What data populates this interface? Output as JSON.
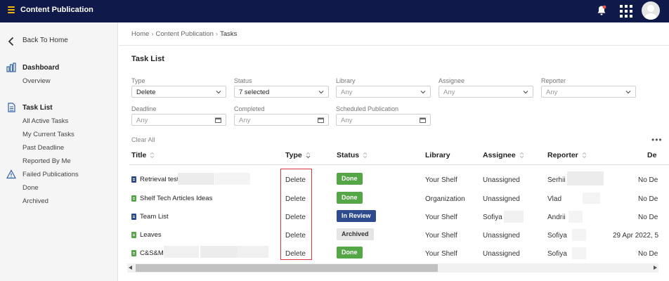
{
  "app": {
    "title": "Content Publication"
  },
  "sidebar": {
    "back_label": "Back To Home",
    "dashboard": {
      "label": "Dashboard",
      "items": [
        "Overview"
      ]
    },
    "tasks": {
      "label": "Task List",
      "items": [
        "All Active Tasks",
        "My Current Tasks",
        "Past Deadline",
        "Reported By Me",
        "Failed Publications",
        "Done",
        "Archived"
      ]
    }
  },
  "breadcrumb": [
    "Home",
    "Content Publication",
    "Tasks"
  ],
  "breadcrumb_sep": "›",
  "page_title": "Task List",
  "filters": [
    {
      "label": "Type",
      "value": "Delete",
      "kind": "select",
      "filled": true
    },
    {
      "label": "Status",
      "value": "7 selected",
      "kind": "select",
      "filled": true
    },
    {
      "label": "Library",
      "value": "Any",
      "kind": "select",
      "filled": false
    },
    {
      "label": "Assignee",
      "value": "Any",
      "kind": "select",
      "filled": false
    },
    {
      "label": "Reporter",
      "value": "Any",
      "kind": "select",
      "filled": false
    },
    {
      "label": "Deadline",
      "value": "Any",
      "kind": "date",
      "filled": false
    },
    {
      "label": "Completed",
      "value": "Any",
      "kind": "date",
      "filled": false
    },
    {
      "label": "Scheduled Publication",
      "value": "Any",
      "kind": "date",
      "filled": false
    }
  ],
  "clear_all": "Clear All",
  "more": "•••",
  "table": {
    "headers": [
      "Title",
      "Type",
      "Status",
      "Library",
      "Assignee",
      "Reporter",
      "De"
    ],
    "rows": [
      {
        "title": "Retrieval test",
        "badge": "blue",
        "type": "Delete",
        "status": "Done",
        "status_kind": "done",
        "library": "Your Shelf",
        "assignee": "Unassigned",
        "reporter": "Serhii",
        "deadline": "No De"
      },
      {
        "title": "Shelf Tech Articles Ideas",
        "badge": "green",
        "type": "Delete",
        "status": "Done",
        "status_kind": "done",
        "library": "Organization",
        "assignee": "Unassigned",
        "reporter": "Vlad",
        "deadline": "No De"
      },
      {
        "title": "Team List",
        "badge": "blue",
        "type": "Delete",
        "status": "In Review",
        "status_kind": "review",
        "library": "Your Shelf",
        "assignee": "Sofiya",
        "reporter": "Andrii",
        "deadline": "No De"
      },
      {
        "title": "Leaves",
        "badge": "green",
        "type": "Delete",
        "status": "Archived",
        "status_kind": "archived",
        "library": "Your Shelf",
        "assignee": "Unassigned",
        "reporter": "Sofiya",
        "deadline": "29 Apr 2022, 5"
      },
      {
        "title": "C&S&M",
        "badge": "green",
        "type": "Delete",
        "status": "Done",
        "status_kind": "done",
        "library": "Your Shelf",
        "assignee": "Unassigned",
        "reporter": "Sofiya",
        "deadline": "No De"
      }
    ]
  },
  "colors": {
    "topbar": "#0f1a4a",
    "accent": "#f2b705",
    "done": "#55a647",
    "review": "#2f4b8f",
    "badge_blue": "#2f4b8f",
    "badge_green": "#55a647",
    "highlight": "#d9363e"
  },
  "icons": {
    "menu": "hamburger-icon",
    "bell": "bell-icon",
    "apps": "apps-grid-icon",
    "back": "chevron-left-icon",
    "dashboard": "bar-chart-icon",
    "tasks": "document-icon",
    "failed": "warning-icon"
  }
}
